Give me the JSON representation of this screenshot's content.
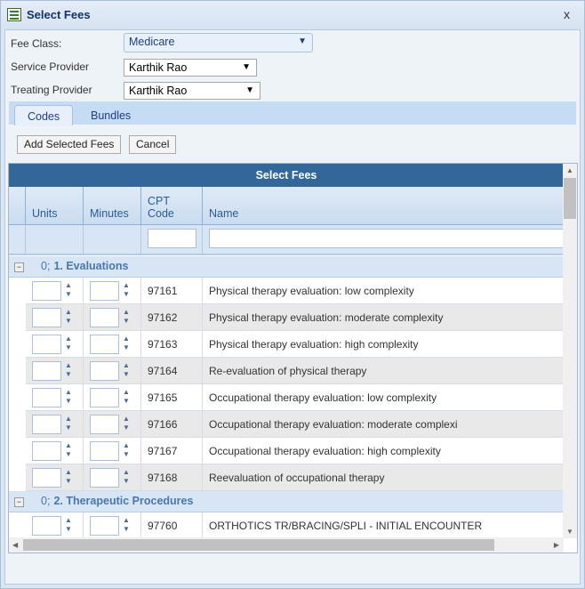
{
  "window": {
    "title": "Select Fees",
    "close": "x"
  },
  "form": {
    "fee_class_label": "Fee Class:",
    "fee_class_value": "Medicare",
    "service_provider_label": "Service Provider",
    "service_provider_value": "Karthik Rao",
    "treating_provider_label": "Treating Provider",
    "treating_provider_value": "Karthik Rao"
  },
  "tabs": [
    {
      "label": "Codes"
    },
    {
      "label": "Bundles"
    }
  ],
  "buttons": {
    "add": "Add Selected Fees",
    "cancel": "Cancel"
  },
  "grid": {
    "title": "Select Fees",
    "columns": {
      "units": "Units",
      "minutes": "Minutes",
      "cpt1": "CPT",
      "cpt2": "Code",
      "name": "Name"
    },
    "groups": [
      {
        "count": "0;",
        "title": "1. Evaluations",
        "rows": [
          {
            "code": "97161",
            "name": "Physical therapy evaluation: low complexity"
          },
          {
            "code": "97162",
            "name": "Physical therapy evaluation: moderate complexity"
          },
          {
            "code": "97163",
            "name": "Physical therapy evaluation: high complexity"
          },
          {
            "code": "97164",
            "name": "Re-evaluation of physical therapy"
          },
          {
            "code": "97165",
            "name": "Occupational therapy evaluation: low complexity"
          },
          {
            "code": "97166",
            "name": "Occupational therapy evaluation: moderate complexi"
          },
          {
            "code": "97167",
            "name": "Occupational therapy evaluation: high complexity"
          },
          {
            "code": "97168",
            "name": "Reevaluation of occupational therapy"
          }
        ]
      },
      {
        "count": "0;",
        "title": "2. Therapeutic Procedures",
        "rows": [
          {
            "code": "97760",
            "name": "ORTHOTICS TR/BRACING/SPLI - INITIAL ENCOUNTER"
          }
        ]
      }
    ]
  }
}
